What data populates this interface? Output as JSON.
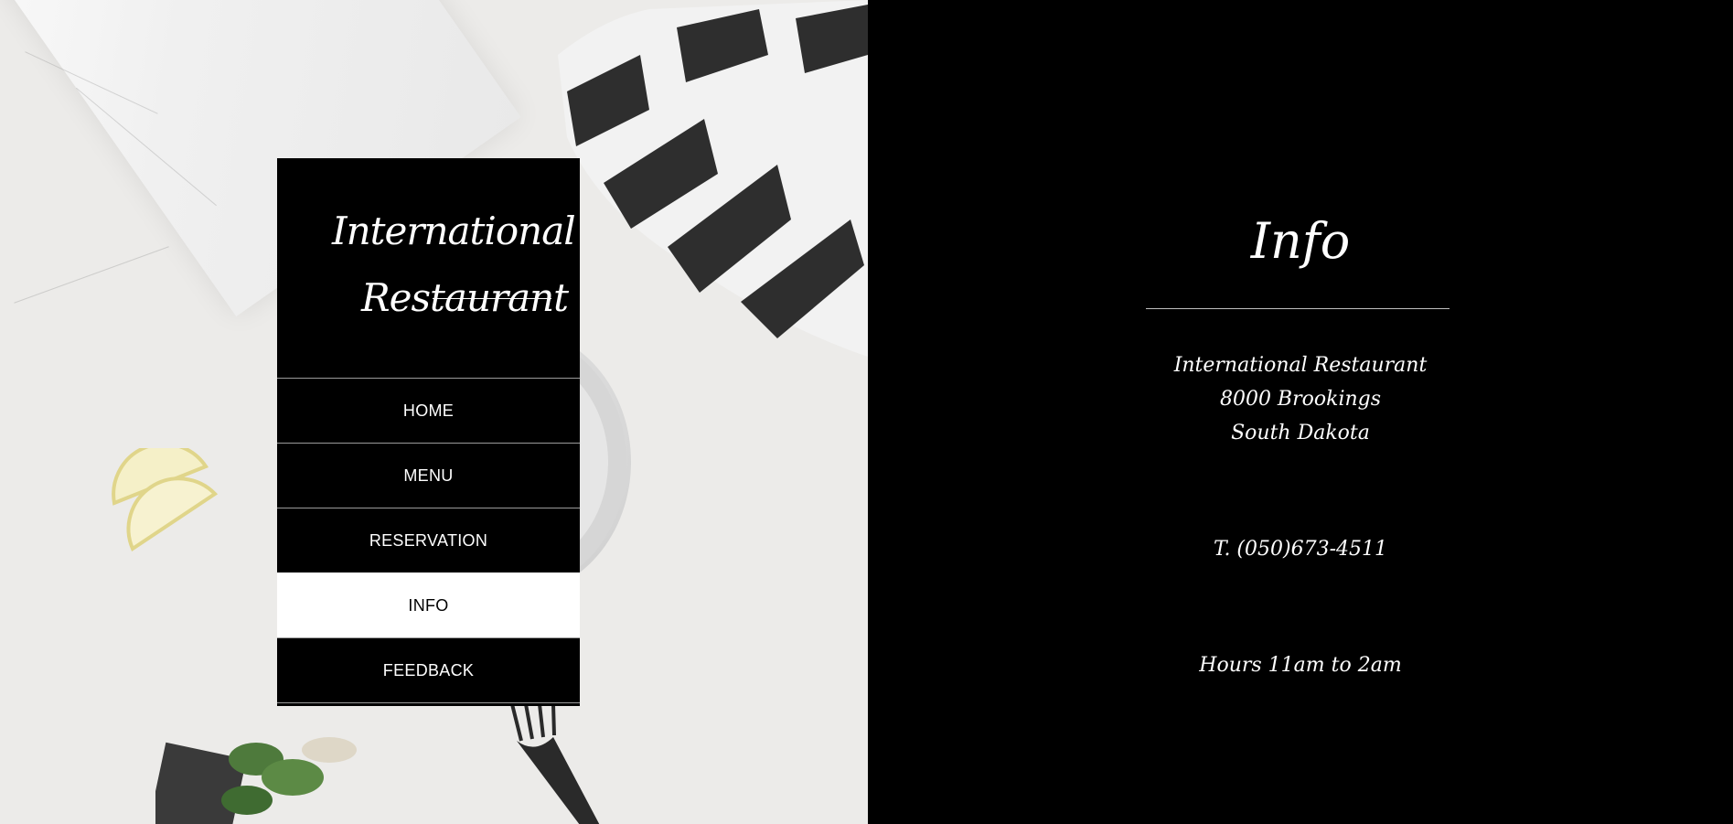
{
  "logo": {
    "line1": "International",
    "line2": "Restaurant"
  },
  "nav": {
    "items": [
      {
        "label": "HOME"
      },
      {
        "label": "MENU"
      },
      {
        "label": "RESERVATION"
      },
      {
        "label": "INFO",
        "active": true
      },
      {
        "label": "FEEDBACK"
      }
    ]
  },
  "info": {
    "heading": "Info",
    "address_line1": "International Restaurant",
    "address_line2": "8000 Brookings",
    "address_line3": "South Dakota",
    "phone": "T. (050)673-4511",
    "hours": "Hours 11am to 2am"
  },
  "colors": {
    "panel": "#000000",
    "active_nav_bg": "#ffffff",
    "divider": "#bfbfbf"
  }
}
